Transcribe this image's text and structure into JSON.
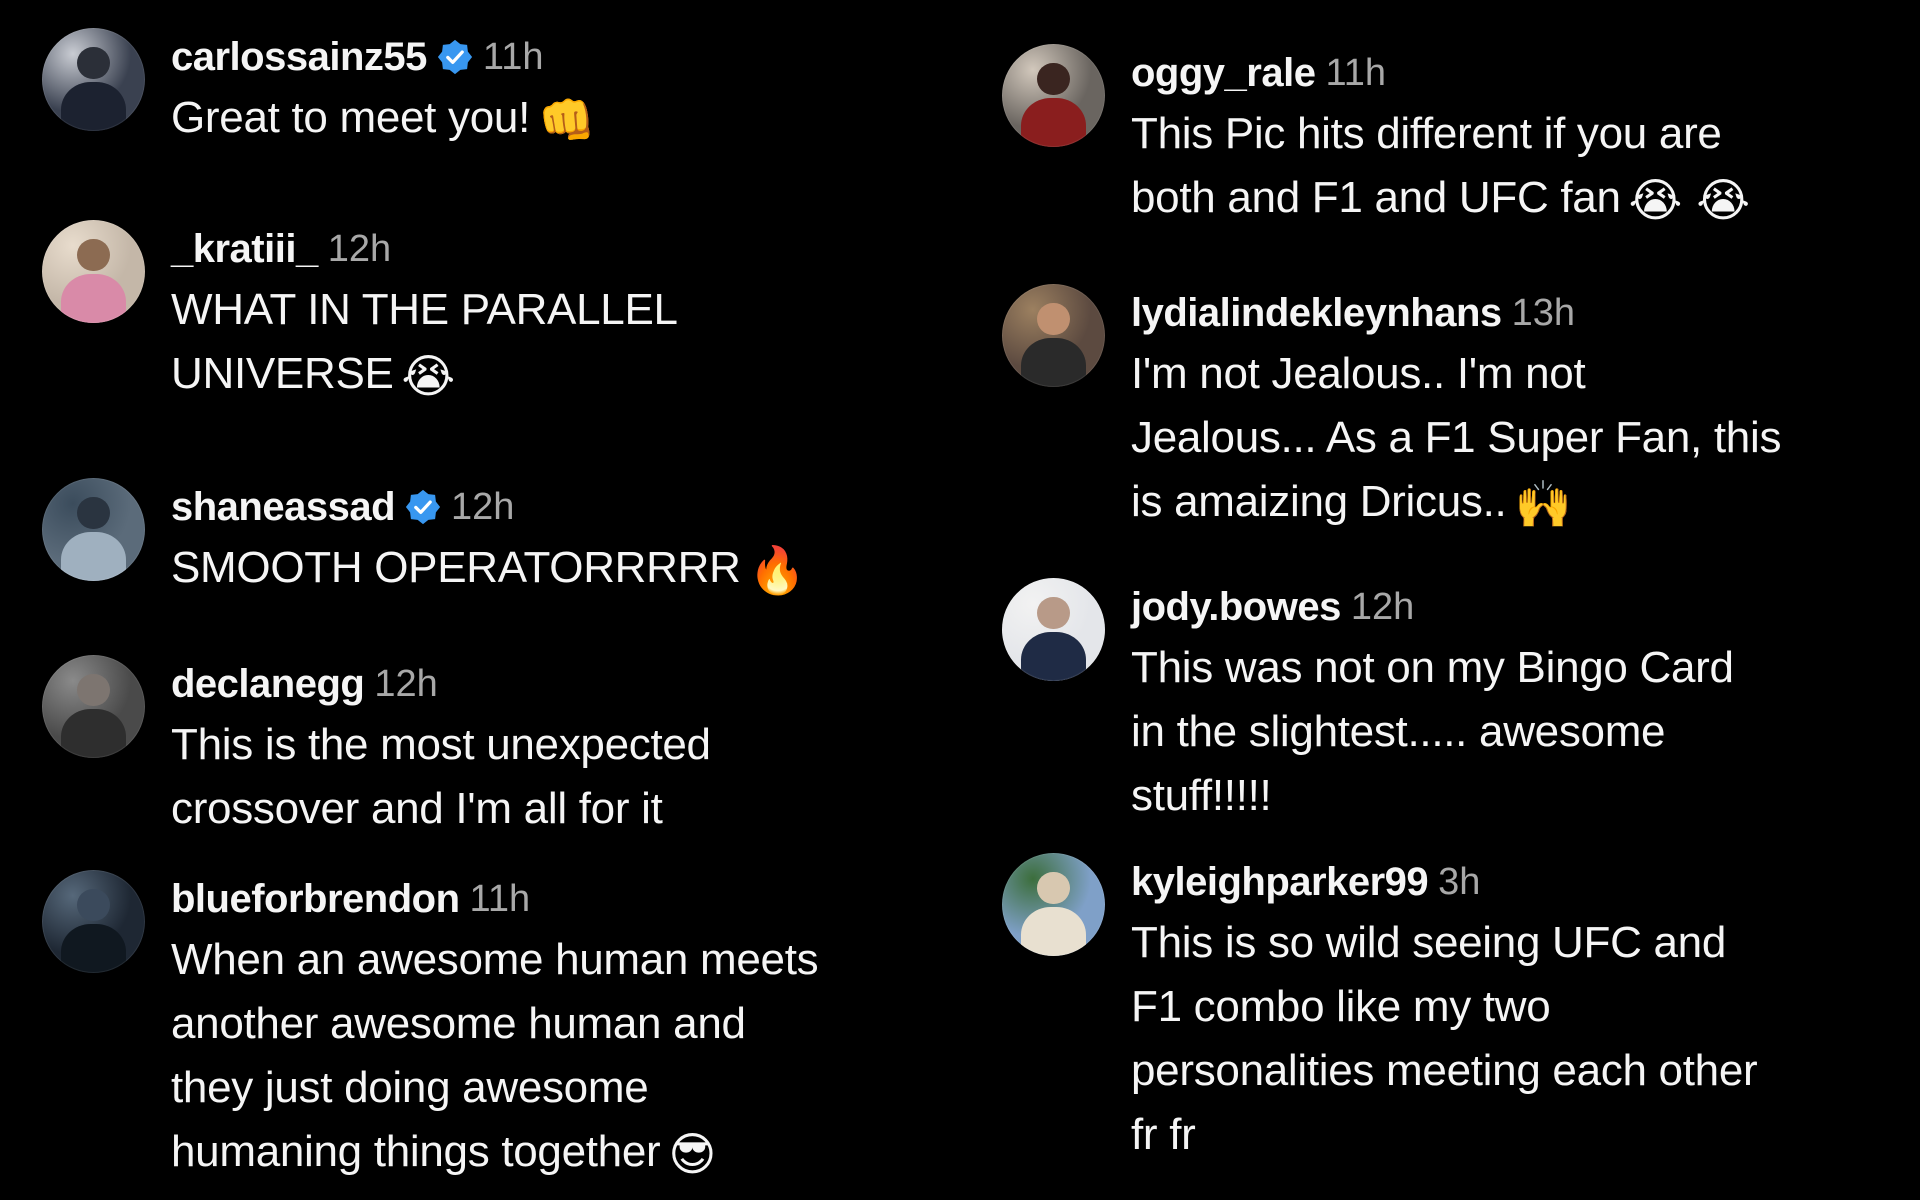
{
  "colors": {
    "background": "#000000",
    "text": "#f5f5f5",
    "timestamp": "#a8a8a8",
    "verified_badge": "#3897f0"
  },
  "left_column": [
    {
      "username": "carlossainz55",
      "verified": true,
      "time": "11h",
      "lines": [
        "Great to meet you!"
      ],
      "emoji": "👊",
      "emoji_name": "fist-bump-emoji"
    },
    {
      "username": "_kratiii_",
      "verified": false,
      "time": "12h",
      "lines": [
        "WHAT IN THE PARALLEL",
        "UNIVERSE"
      ],
      "emoji": "😭",
      "emoji_name": "loudly-crying-emoji"
    },
    {
      "username": "shaneassad",
      "verified": true,
      "time": "12h",
      "lines": [
        "SMOOTH OPERATORRRRR"
      ],
      "emoji": "🔥",
      "emoji_name": "fire-emoji"
    },
    {
      "username": "declanegg",
      "verified": false,
      "time": "12h",
      "lines": [
        "This is the most unexpected",
        "crossover and I'm all for it"
      ],
      "emoji": "",
      "emoji_name": ""
    },
    {
      "username": "blueforbrendon",
      "verified": false,
      "time": "11h",
      "lines": [
        "When an awesome human meets",
        "another awesome human and",
        "they just doing awesome",
        "humaning things together"
      ],
      "emoji": "😎",
      "emoji_name": "sunglasses-emoji"
    }
  ],
  "right_column": [
    {
      "username": "oggy_rale",
      "verified": false,
      "time": "11h",
      "lines": [
        "This Pic hits different if you are",
        "both and F1 and UFC fan"
      ],
      "emoji": "😭 😭",
      "emoji_name": "loudly-crying-emoji"
    },
    {
      "username": "lydialindekleynhans",
      "verified": false,
      "time": "13h",
      "lines": [
        "I'm not Jealous.. I'm not",
        "Jealous... As a F1 Super Fan, this",
        "is amaizing Dricus.."
      ],
      "emoji": "🙌",
      "emoji_name": "raising-hands-emoji"
    },
    {
      "username": "jody.bowes",
      "verified": false,
      "time": "12h",
      "lines": [
        "This was not on my Bingo Card",
        "in the slightest..... awesome",
        "stuff!!!!!"
      ],
      "emoji": "",
      "emoji_name": ""
    },
    {
      "username": "kyleighparker99",
      "verified": false,
      "time": "3h",
      "lines": [
        "This is so wild seeing UFC and",
        "F1 combo like my two",
        "personalities meeting each other",
        "fr fr"
      ],
      "emoji": "",
      "emoji_name": ""
    }
  ]
}
